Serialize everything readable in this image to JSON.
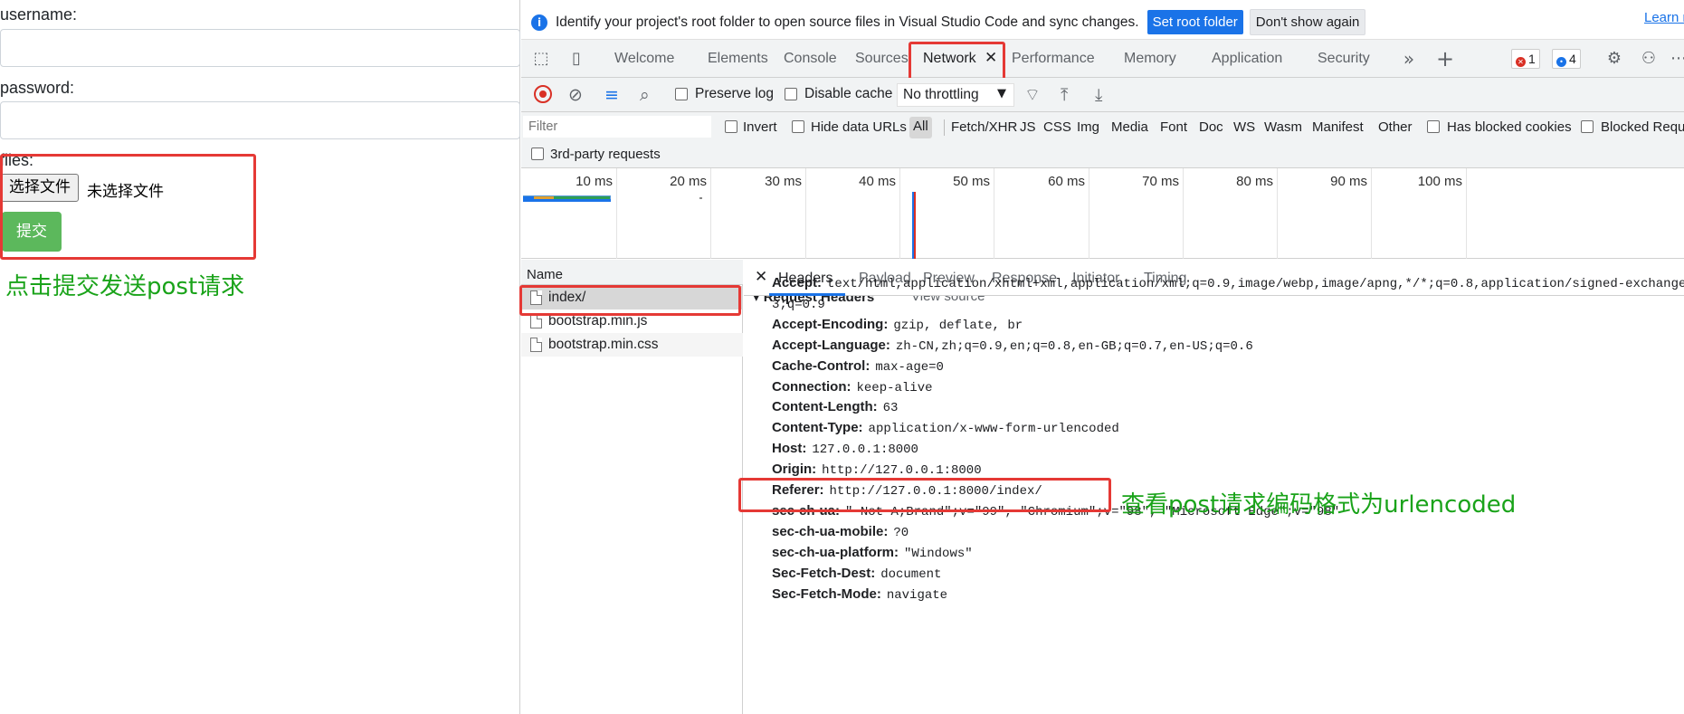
{
  "form": {
    "username_label": "username:",
    "password_label": "password:",
    "files_label": "files:",
    "file_button": "选择文件",
    "file_status": "未选择文件",
    "submit_label": "提交",
    "annotation": "点击提交发送post请求"
  },
  "infobar": {
    "icon": "i",
    "message": "Identify your project's root folder to open source files in Visual Studio Code and sync changes.",
    "set_root": "Set root folder",
    "dont_show": "Don't show again",
    "learn_more": "Learn n"
  },
  "tabs": [
    {
      "label": "Welcome"
    },
    {
      "label": "Elements"
    },
    {
      "label": "Console"
    },
    {
      "label": "Sources"
    },
    {
      "label": "Network"
    },
    {
      "label": "Performance"
    },
    {
      "label": "Memory"
    },
    {
      "label": "Application"
    },
    {
      "label": "Security"
    }
  ],
  "badges": {
    "errors": "1",
    "messages": "4"
  },
  "toolbar": {
    "preserve_log": "Preserve log",
    "disable_cache": "Disable cache",
    "throttling": "No throttling"
  },
  "filter": {
    "placeholder": "Filter",
    "invert": "Invert",
    "hide_data_urls": "Hide data URLs",
    "all": "All",
    "types": [
      "Fetch/XHR",
      "JS",
      "CSS",
      "Img",
      "Media",
      "Font",
      "Doc",
      "WS",
      "Wasm",
      "Manifest",
      "Other"
    ],
    "has_blocked_cookies": "Has blocked cookies",
    "blocked_requests": "Blocked Reque",
    "third_party": "3rd-party requests"
  },
  "timeline": {
    "ticks": [
      "10 ms",
      "20 ms",
      "30 ms",
      "40 ms",
      "50 ms",
      "60 ms",
      "70 ms",
      "80 ms",
      "90 ms",
      "100 ms"
    ]
  },
  "requests": {
    "header": "Name",
    "items": [
      {
        "name": "index/"
      },
      {
        "name": "bootstrap.min.js"
      },
      {
        "name": "bootstrap.min.css"
      }
    ]
  },
  "detail": {
    "tabs": [
      "Headers",
      "Payload",
      "Preview",
      "Response",
      "Initiator",
      "Timing"
    ],
    "section_title": "Request Headers",
    "view_source": "View source",
    "headers": [
      {
        "name": "Accept:",
        "value": "text/html,application/xhtml+xml,application/xml;q=0.9,image/webp,image/apng,*/*;q=0.8,application/signed-exchange;v"
      },
      {
        "name": "",
        "value": "3;q=0.9"
      },
      {
        "name": "Accept-Encoding:",
        "value": "gzip, deflate, br"
      },
      {
        "name": "Accept-Language:",
        "value": "zh-CN,zh;q=0.9,en;q=0.8,en-GB;q=0.7,en-US;q=0.6"
      },
      {
        "name": "Cache-Control:",
        "value": "max-age=0"
      },
      {
        "name": "Connection:",
        "value": "keep-alive"
      },
      {
        "name": "Content-Length:",
        "value": "63"
      },
      {
        "name": "Content-Type:",
        "value": "application/x-www-form-urlencoded"
      },
      {
        "name": "Host:",
        "value": "127.0.0.1:8000"
      },
      {
        "name": "Origin:",
        "value": "http://127.0.0.1:8000"
      },
      {
        "name": "Referer:",
        "value": "http://127.0.0.1:8000/index/"
      },
      {
        "name": "sec-ch-ua:",
        "value": "\" Not A;Brand\";v=\"99\", \"Chromium\";v=\"98\", \"Microsoft Edge\";v=\"98\""
      },
      {
        "name": "sec-ch-ua-mobile:",
        "value": "?0"
      },
      {
        "name": "sec-ch-ua-platform:",
        "value": "\"Windows\""
      },
      {
        "name": "Sec-Fetch-Dest:",
        "value": "document"
      },
      {
        "name": "Sec-Fetch-Mode:",
        "value": "navigate"
      }
    ],
    "annotation": "查看post请求编码格式为urlencoded"
  },
  "colors": {
    "accent": "#1a73e8",
    "annotation": "#1aa31a",
    "highlight": "#e53935",
    "submit": "#5cb85c"
  }
}
